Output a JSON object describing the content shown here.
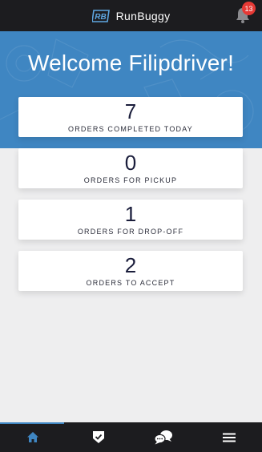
{
  "header": {
    "brand_name": "RunBuggy",
    "brand_logo_text": "RB",
    "notification_count": "13"
  },
  "hero": {
    "welcome": "Welcome Filipdriver!"
  },
  "cards": [
    {
      "count": "7",
      "label": "ORDERS COMPLETED TODAY"
    },
    {
      "count": "0",
      "label": "ORDERS FOR PICKUP"
    },
    {
      "count": "1",
      "label": "ORDERS FOR DROP-OFF"
    },
    {
      "count": "2",
      "label": "ORDERS TO ACCEPT"
    }
  ],
  "bottom_nav": {
    "items": [
      {
        "icon": "home-icon",
        "active": true
      },
      {
        "icon": "shield-check-icon",
        "active": false
      },
      {
        "icon": "chat-bubbles-icon",
        "active": false
      },
      {
        "icon": "menu-icon",
        "active": false
      }
    ]
  },
  "colors": {
    "accent": "#3f86c2",
    "bar": "#1c1c1f",
    "badge": "#e53935",
    "background": "#eeeeef"
  }
}
